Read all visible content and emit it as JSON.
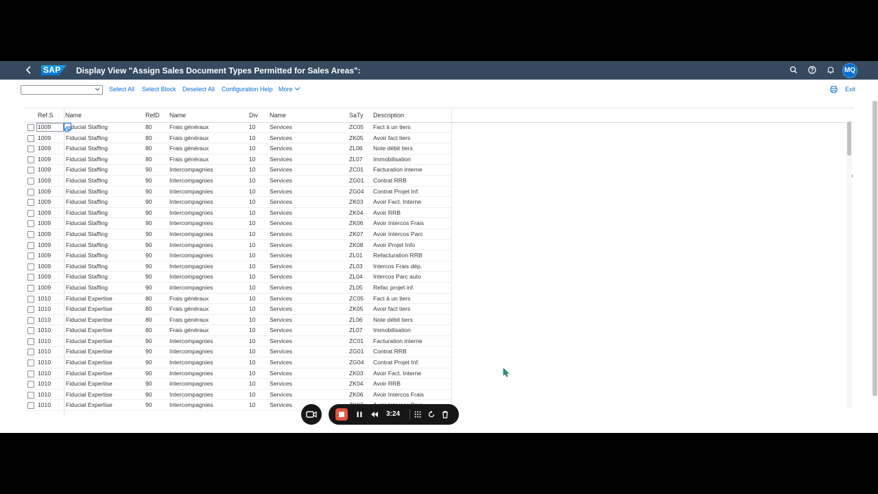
{
  "shell": {
    "title": "Display View \"Assign Sales Document Types Permitted for Sales Areas\":",
    "logo": "SAP",
    "avatar": "MQ"
  },
  "toolbar": {
    "combo_value": "",
    "buttons": [
      "Select All",
      "Select Block",
      "Deselect All",
      "Configuration Help",
      "More"
    ],
    "exit": "Exit"
  },
  "table": {
    "headers": [
      "Ref.S",
      "Name",
      "RefD",
      "Name",
      "Div",
      "Name",
      "SaTy",
      "Description"
    ],
    "rows": [
      [
        "1009",
        "Fiducial Staffing",
        "80",
        "Frais généraux",
        "10",
        "Services",
        "ZC05",
        "Fact à un tiers"
      ],
      [
        "1009",
        "Fiducial Staffing",
        "80",
        "Frais généraux",
        "10",
        "Services",
        "ZK05",
        "Avoir fact tiers"
      ],
      [
        "1009",
        "Fiducial Staffing",
        "80",
        "Frais généraux",
        "10",
        "Services",
        "ZL06",
        "Note débit tiers"
      ],
      [
        "1009",
        "Fiducial Staffing",
        "80",
        "Frais généraux",
        "10",
        "Services",
        "ZL07",
        "Immobilisation"
      ],
      [
        "1009",
        "Fiducial Staffing",
        "90",
        "Intercompagnies",
        "10",
        "Services",
        "ZC01",
        "Facturation interne"
      ],
      [
        "1009",
        "Fiducial Staffing",
        "90",
        "Intercompagnies",
        "10",
        "Services",
        "ZG01",
        "Contrat RRB"
      ],
      [
        "1009",
        "Fiducial Staffing",
        "90",
        "Intercompagnies",
        "10",
        "Services",
        "ZG04",
        "Contrat Projet Inf."
      ],
      [
        "1009",
        "Fiducial Staffing",
        "90",
        "Intercompagnies",
        "10",
        "Services",
        "ZK03",
        "Avoir Fact. Interne"
      ],
      [
        "1009",
        "Fiducial Staffing",
        "90",
        "Intercompagnies",
        "10",
        "Services",
        "ZK04",
        "Avoir RRB"
      ],
      [
        "1009",
        "Fiducial Staffing",
        "90",
        "Intercompagnies",
        "10",
        "Services",
        "ZK06",
        "Avoir Intercos Frais"
      ],
      [
        "1009",
        "Fiducial Staffing",
        "90",
        "Intercompagnies",
        "10",
        "Services",
        "ZK07",
        "Avoir Intercos Parc"
      ],
      [
        "1009",
        "Fiducial Staffing",
        "90",
        "Intercompagnies",
        "10",
        "Services",
        "ZK08",
        "Avoir Projet Info"
      ],
      [
        "1009",
        "Fiducial Staffing",
        "90",
        "Intercompagnies",
        "10",
        "Services",
        "ZL01",
        "Refacturation RRB"
      ],
      [
        "1009",
        "Fiducial Staffing",
        "90",
        "Intercompagnies",
        "10",
        "Services",
        "ZL03",
        "Intercos Frais dép."
      ],
      [
        "1009",
        "Fiducial Staffing",
        "90",
        "Intercompagnies",
        "10",
        "Services",
        "ZL04",
        "Intercos Parc auto"
      ],
      [
        "1009",
        "Fiducial Staffing",
        "90",
        "Intercompagnies",
        "10",
        "Services",
        "ZL05",
        "Refac projet inf."
      ],
      [
        "1010",
        "Fiducial Expertise",
        "80",
        "Frais généraux",
        "10",
        "Services",
        "ZC05",
        "Fact à un tiers"
      ],
      [
        "1010",
        "Fiducial Expertise",
        "80",
        "Frais généraux",
        "10",
        "Services",
        "ZK05",
        "Avoir fact tiers"
      ],
      [
        "1010",
        "Fiducial Expertise",
        "80",
        "Frais généraux",
        "10",
        "Services",
        "ZL06",
        "Note débit tiers"
      ],
      [
        "1010",
        "Fiducial Expertise",
        "80",
        "Frais généraux",
        "10",
        "Services",
        "ZL07",
        "Immobilisation"
      ],
      [
        "1010",
        "Fiducial Expertise",
        "90",
        "Intercompagnies",
        "10",
        "Services",
        "ZC01",
        "Facturation interne"
      ],
      [
        "1010",
        "Fiducial Expertise",
        "90",
        "Intercompagnies",
        "10",
        "Services",
        "ZG01",
        "Contrat RRB"
      ],
      [
        "1010",
        "Fiducial Expertise",
        "90",
        "Intercompagnies",
        "10",
        "Services",
        "ZG04",
        "Contrat Projet Inf."
      ],
      [
        "1010",
        "Fiducial Expertise",
        "90",
        "Intercompagnies",
        "10",
        "Services",
        "ZK03",
        "Avoir Fact. Interne"
      ],
      [
        "1010",
        "Fiducial Expertise",
        "90",
        "Intercompagnies",
        "10",
        "Services",
        "ZK04",
        "Avoir RRB"
      ],
      [
        "1010",
        "Fiducial Expertise",
        "90",
        "Intercompagnies",
        "10",
        "Services",
        "ZK06",
        "Avoir Intercos Frais"
      ],
      [
        "1010",
        "Fiducial Expertise",
        "90",
        "Intercompagnies",
        "10",
        "Services",
        "ZK07",
        "Avoir Intercos Parc"
      ]
    ]
  },
  "recorder": {
    "time": "3:24",
    "stop_color": "#e5533d"
  },
  "colors": {
    "shell": "#354a5f",
    "link": "#0a6ed1"
  }
}
